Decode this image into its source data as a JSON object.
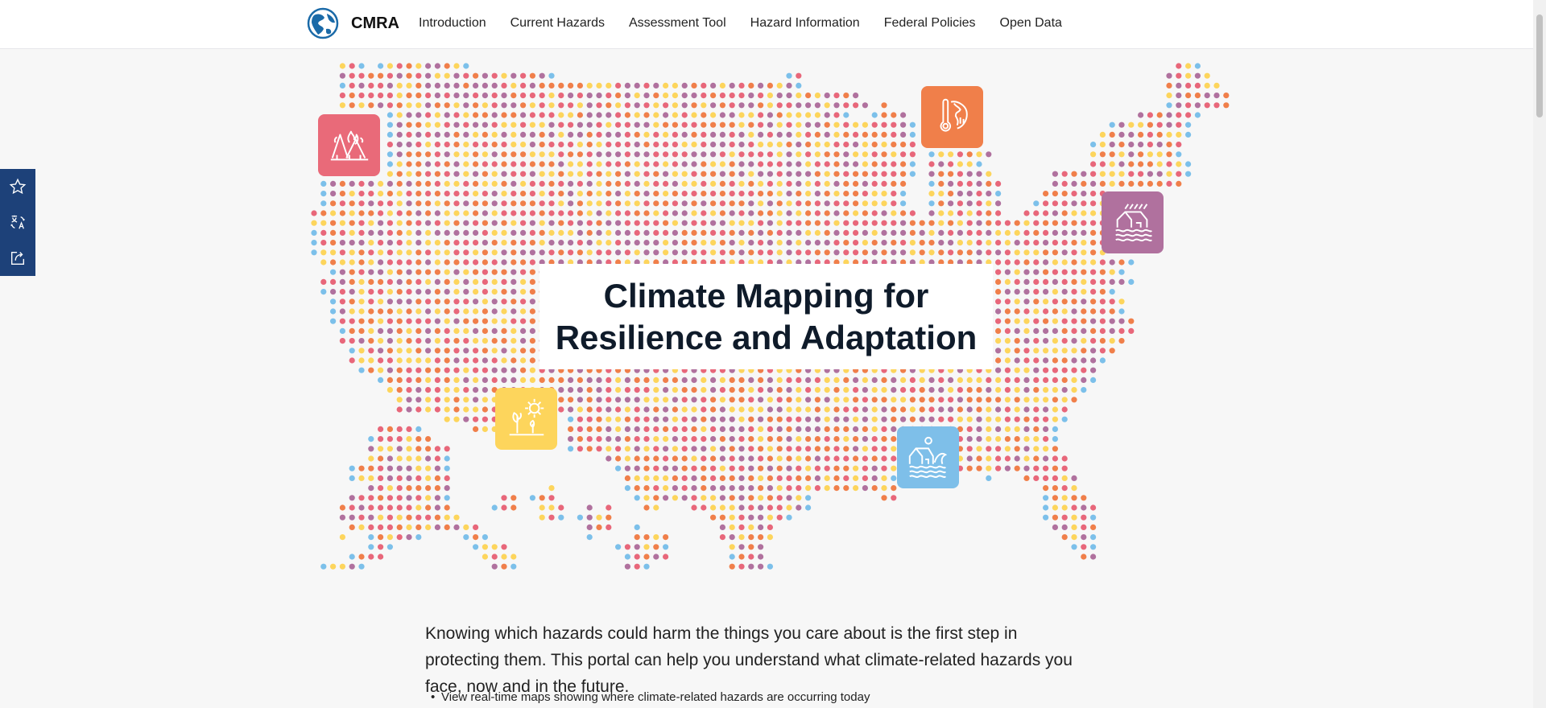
{
  "header": {
    "brand": "CMRA",
    "nav": [
      "Introduction",
      "Current Hazards",
      "Assessment Tool",
      "Hazard Information",
      "Federal Policies",
      "Open Data"
    ]
  },
  "sidebar": {
    "items": [
      "star-icon",
      "translate-icon",
      "share-icon"
    ]
  },
  "hero": {
    "title_line1": "Climate Mapping for",
    "title_line2": "Resilience and Adaptation",
    "dot_colors": [
      "#e8677a",
      "#b0719e",
      "#fdd55c",
      "#f07f4a"
    ],
    "edge_color": "#7cc0ea",
    "icons": [
      {
        "name": "wildfire-icon",
        "color": "#e96a79"
      },
      {
        "name": "extreme-heat-icon",
        "color": "#f07f4a"
      },
      {
        "name": "inland-flooding-icon",
        "color": "#b0719e"
      },
      {
        "name": "drought-icon",
        "color": "#fdd55c"
      },
      {
        "name": "coastal-flooding-icon",
        "color": "#7ebfe9"
      }
    ]
  },
  "intro": {
    "paragraph": "Knowing which hazards could harm the things you care about is the first step in protecting them. This portal can help you understand what climate-related hazards you face, now and in the future.",
    "bullets": [
      "View real-time maps showing where climate-related hazards are occurring today"
    ]
  }
}
